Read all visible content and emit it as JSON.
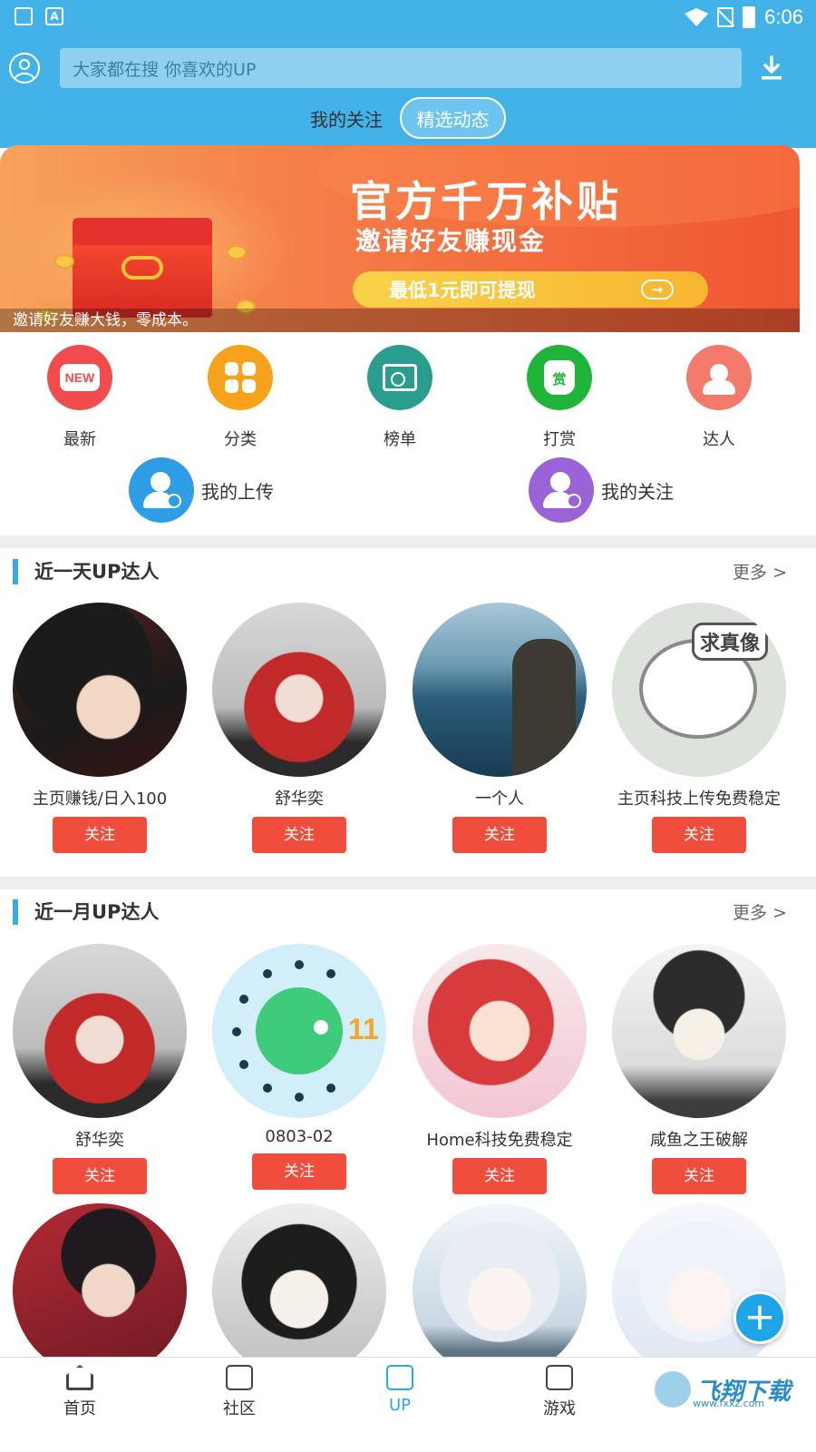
{
  "status_bar": {
    "time": "6:06",
    "battery_level": "6"
  },
  "header": {
    "search_placeholder": "大家都在搜  你喜欢的UP",
    "tabs": [
      {
        "label": "我的关注",
        "active": false
      },
      {
        "label": "精选动态",
        "active": true
      }
    ]
  },
  "banner": {
    "title": "官方千万补贴",
    "subtitle": "邀请好友赚现金",
    "button_label": "最低1元即可提现",
    "caption": "邀请好友赚大钱，零成本。"
  },
  "categories": [
    {
      "label": "最新",
      "icon": "new-icon",
      "color": "#f24b4e"
    },
    {
      "label": "分类",
      "icon": "grid-icon",
      "color": "#f7a21b"
    },
    {
      "label": "榜单",
      "icon": "certificate-icon",
      "color": "#2a9d8f"
    },
    {
      "label": "打赏",
      "icon": "money-bag-icon",
      "color": "#1eb53a"
    },
    {
      "label": "达人",
      "icon": "expert-icon",
      "color": "#f47a6b"
    }
  ],
  "quick_links": [
    {
      "label": "我的上传",
      "icon": "upload-user-icon",
      "color": "#2d9de6"
    },
    {
      "label": "我的关注",
      "icon": "follow-user-icon",
      "color": "#9a63d8"
    }
  ],
  "section_day": {
    "title": "近一天UP达人",
    "more": "更多 >",
    "users": [
      {
        "name": "主页赚钱/日入100",
        "follow": "关注"
      },
      {
        "name": "舒华奕",
        "follow": "关注"
      },
      {
        "name": "一个人",
        "follow": "关注"
      },
      {
        "name": "主页科技上传免费稳定",
        "follow": "关注"
      }
    ]
  },
  "section_month": {
    "title": "近一月UP达人",
    "more": "更多 >",
    "users": [
      {
        "name": "舒华奕",
        "follow": "关注"
      },
      {
        "name": "0803-02",
        "follow": "关注"
      },
      {
        "name": "Home科技免费稳定",
        "follow": "关注"
      },
      {
        "name": "咸鱼之王破解",
        "follow": "关注"
      }
    ]
  },
  "meme_avatar_text": "求真像",
  "android_avatar_text": "11",
  "bottom_nav": [
    {
      "label": "首页",
      "icon": "home-icon",
      "active": false
    },
    {
      "label": "社区",
      "icon": "community-icon",
      "active": false
    },
    {
      "label": "UP",
      "icon": "up-icon",
      "active": true
    },
    {
      "label": "游戏",
      "icon": "gamepad-icon",
      "active": false
    }
  ],
  "watermark": {
    "text": "飞翔下载",
    "sub": "www.fxxz.com"
  },
  "colors": {
    "header": "#43b2e8",
    "accent": "#3aa9e3",
    "follow_button": "#f04d3c"
  }
}
